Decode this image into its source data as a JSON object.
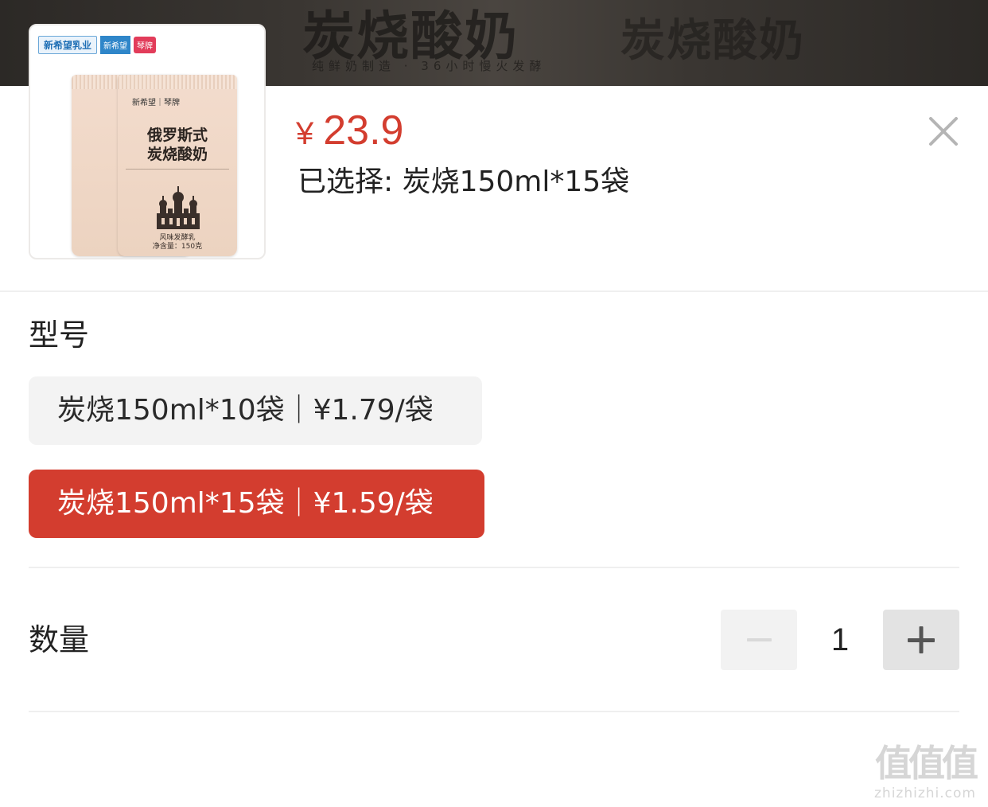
{
  "banner": {
    "title": "炭烧酸奶",
    "title_repeat": "炭烧酸奶",
    "subtitle": "纯鲜奶制造 · 36小时慢火发酵"
  },
  "product": {
    "image": {
      "brand_main": "新希望乳业",
      "brand_tag": "新希望",
      "brand_badge": "琴牌",
      "bag_brand": "新希望｜琴牌",
      "bag_title_line1": "俄罗斯式",
      "bag_title_line2": "炭烧酸奶",
      "bag_type": "风味发酵乳",
      "bag_weight": "净含量：150克"
    },
    "price_symbol": "¥",
    "price_value": "23.9",
    "selected_text": "已选择: 炭烧150ml*15袋"
  },
  "model_section": {
    "label": "型号",
    "options": [
      {
        "label": "炭烧150ml*10袋｜¥1.79/袋",
        "selected": false
      },
      {
        "label": "炭烧150ml*15袋｜¥1.59/袋",
        "selected": true
      }
    ]
  },
  "quantity_section": {
    "label": "数量",
    "value": "1"
  },
  "watermark": {
    "glyphs": "值值值",
    "domain": "zhizhizhi.com"
  },
  "icons": {
    "close": "close-icon",
    "minus": "minus-icon",
    "plus": "plus-icon"
  },
  "colors": {
    "accent": "#d33d2f",
    "option_bg": "#f3f3f3",
    "divider": "#efefef"
  }
}
